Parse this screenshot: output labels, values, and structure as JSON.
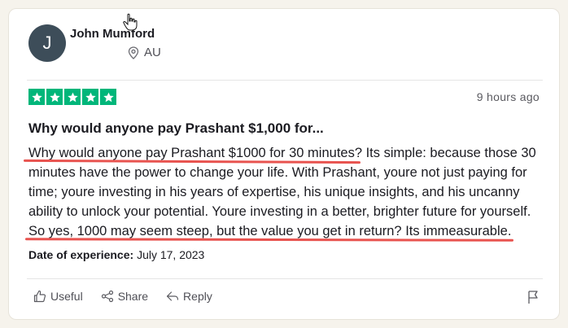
{
  "reviewer": {
    "initial": "J",
    "name": "John Mumford",
    "country": "AU",
    "avatar_color": "#3d4d59"
  },
  "review": {
    "rating": 5,
    "star_color": "#00b67a",
    "timestamp": "9 hours ago",
    "title": "Why would anyone pay Prashant $1,000 for...",
    "body": "Why would anyone pay Prashant $1000 for 30 minutes? Its simple: because those 30 minutes have the power to change your life. With Prashant, youre not just paying for time; youre investing in his years of expertise, his unique insights, and his uncanny ability to unlock your potential. Youre investing in a better, brighter future for yourself. So yes, 1000 may seem steep, but the value you get in return? Its immeasurable.",
    "date_label": "Date of experience:",
    "date_value": "July 17, 2023"
  },
  "highlight_color": "#e8534f",
  "actions": {
    "useful": "Useful",
    "share": "Share",
    "reply": "Reply"
  },
  "icons": {
    "pin": "location-pin-icon",
    "thumb": "thumbs-up-icon",
    "share": "share-icon",
    "reply": "reply-arrow-icon",
    "flag": "flag-icon",
    "cursor": "hand-cursor-icon"
  }
}
